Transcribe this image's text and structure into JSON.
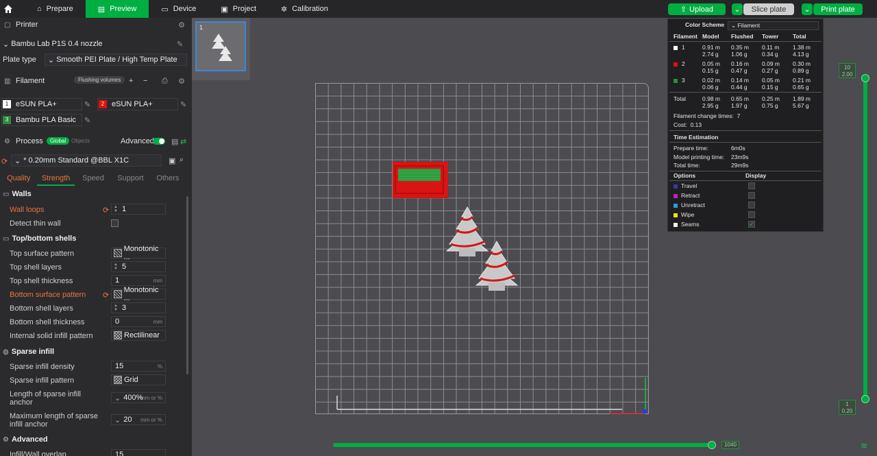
{
  "topbar": {
    "tabs": [
      {
        "label": "Prepare",
        "icon": "prepare-icon"
      },
      {
        "label": "Preview",
        "icon": "preview-icon",
        "active": true
      },
      {
        "label": "Device",
        "icon": "device-icon"
      },
      {
        "label": "Project",
        "icon": "project-icon"
      },
      {
        "label": "Calibration",
        "icon": "calibration-icon"
      }
    ],
    "upload": "Upload",
    "slice": "Slice plate",
    "print": "Print plate"
  },
  "printer": {
    "section": "Printer",
    "name": "Bambu Lab P1S 0.4 nozzle",
    "plate_type_label": "Plate type",
    "plate_type": "Smooth PEI Plate / High Temp Plate"
  },
  "filament": {
    "section": "Filament",
    "flushing": "Flushing volumes",
    "slots": [
      {
        "num": "1",
        "name": "eSUN PLA+",
        "color": "#ffffff"
      },
      {
        "num": "2",
        "name": "eSUN PLA+",
        "color": "#e01010"
      },
      {
        "num": "3",
        "name": "Bambu PLA Basic",
        "color": "#2e8b3a"
      }
    ]
  },
  "process": {
    "section": "Process",
    "global": "Global",
    "objects": "Objects",
    "advanced": "Advanced",
    "preset": "* 0.20mm Standard @BBL X1C",
    "tabs": [
      "Quality",
      "Strength",
      "Speed",
      "Support",
      "Others"
    ],
    "groups": {
      "walls": "Walls",
      "topbottom": "Top/bottom shells",
      "sparse": "Sparse infill",
      "advanced": "Advanced"
    },
    "settings": {
      "wall_loops": {
        "label": "Wall loops",
        "value": "1"
      },
      "detect_thin": {
        "label": "Detect thin wall"
      },
      "top_pattern": {
        "label": "Top surface pattern",
        "value": "Monotonic ..."
      },
      "top_layers": {
        "label": "Top shell layers",
        "value": "5"
      },
      "top_thick": {
        "label": "Top shell thickness",
        "value": "1",
        "unit": "mm"
      },
      "bottom_pattern": {
        "label": "Bottom surface pattern",
        "value": "Monotonic ..."
      },
      "bottom_layers": {
        "label": "Bottom shell layers",
        "value": "3"
      },
      "bottom_thick": {
        "label": "Bottom shell thickness",
        "value": "0",
        "unit": "mm"
      },
      "internal_pattern": {
        "label": "Internal solid infill pattern",
        "value": "Rectilinear"
      },
      "sparse_density": {
        "label": "Sparse infill density",
        "value": "15",
        "unit": "%"
      },
      "sparse_pattern": {
        "label": "Sparse infill pattern",
        "value": "Grid"
      },
      "anchor_len_1": "Length of sparse infill",
      "anchor_len_2": "anchor",
      "anchor_len_value": "400%",
      "anchor_len_unit": "mm or %",
      "anchor_max_1": "Maximum length of sparse",
      "anchor_max_2": "infill anchor",
      "anchor_max_value": "20",
      "anchor_max_unit": "mm or %",
      "overlap": {
        "label": "Infill/Wall overlap",
        "value": "15"
      }
    }
  },
  "legend": {
    "color_scheme": "Color Scheme",
    "scheme": "Filament",
    "headers": [
      "Filament",
      "Model",
      "Flushed",
      "Tower",
      "Total"
    ],
    "rows": [
      {
        "num": "1",
        "color": "#ffffff",
        "model": [
          "0.91 m",
          "2.74 g"
        ],
        "flushed": [
          "0.35 m",
          "1.06 g"
        ],
        "tower": [
          "0.11 m",
          "0.34 g"
        ],
        "total": [
          "1.38 m",
          "4.13 g"
        ]
      },
      {
        "num": "2",
        "color": "#e01010",
        "model": [
          "0.05 m",
          "0.15 g"
        ],
        "flushed": [
          "0.16 m",
          "0.47 g"
        ],
        "tower": [
          "0.09 m",
          "0.27 g"
        ],
        "total": [
          "0.30 m",
          "0.89 g"
        ]
      },
      {
        "num": "3",
        "color": "#2e8b3a",
        "model": [
          "0.02 m",
          "0.06 g"
        ],
        "flushed": [
          "0.14 m",
          "0.44 g"
        ],
        "tower": [
          "0.05 m",
          "0.15 g"
        ],
        "total": [
          "0.21 m",
          "0.65 g"
        ]
      }
    ],
    "total": {
      "label": "Total",
      "model": [
        "0.98 m",
        "2.95 g"
      ],
      "flushed": [
        "0.65 m",
        "1.97 g"
      ],
      "tower": [
        "0.25 m",
        "0.75 g"
      ],
      "total": [
        "1.89 m",
        "5.67 g"
      ]
    },
    "change_times": "Filament change times:",
    "change_value": "7",
    "cost_label": "Cost:",
    "cost_value": "0.13",
    "time_title": "Time Estimation",
    "times": [
      {
        "label": "Prepare time:",
        "value": "6m0s"
      },
      {
        "label": "Model printing time:",
        "value": "23m9s"
      },
      {
        "label": "Total time:",
        "value": "29m9s"
      }
    ],
    "options_hd": "Options",
    "display_hd": "Display",
    "options": [
      {
        "label": "Travel",
        "color": "#3a3aa0",
        "checked": false
      },
      {
        "label": "Retract",
        "color": "#c020c0",
        "checked": false
      },
      {
        "label": "Unretract",
        "color": "#20a0e0",
        "checked": false
      },
      {
        "label": "Wipe",
        "color": "#f0e020",
        "checked": false
      },
      {
        "label": "Seams",
        "color": "#f0f0f0",
        "checked": true
      }
    ]
  },
  "layer_slider": {
    "top_layer": "10",
    "top_height": "2.00",
    "bottom_layer": "1",
    "bottom_height": "0.20"
  },
  "move_slider": {
    "value": "1040"
  },
  "plate_number": "1",
  "colors": {
    "accent": "#00ae42",
    "modified": "#e8743b"
  }
}
